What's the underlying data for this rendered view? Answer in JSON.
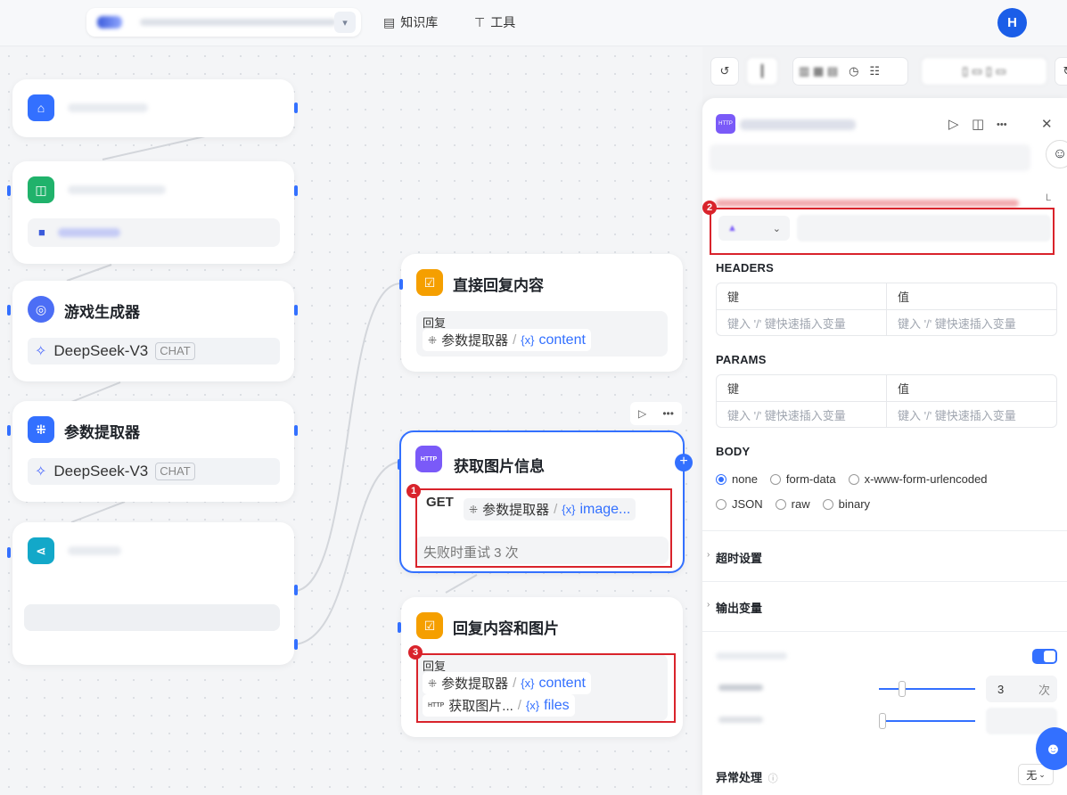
{
  "topbar": {
    "nav": [
      {
        "label": "知识库",
        "icon": "book-icon"
      },
      {
        "label": "工具",
        "icon": "tool-icon"
      }
    ],
    "avatar_letter": "H"
  },
  "canvas": {
    "nodes": {
      "game_gen": {
        "title": "游戏生成器",
        "model": "DeepSeek-V3",
        "tag": "CHAT"
      },
      "param_extract": {
        "title": "参数提取器",
        "model": "DeepSeek-V3",
        "tag": "CHAT"
      },
      "direct_reply": {
        "title": "直接回复内容",
        "sub_label": "回复",
        "var_source": "参数提取器",
        "var_name": "content"
      },
      "http_node": {
        "title": "获取图片信息",
        "icon_text": "HTTP",
        "method": "GET",
        "var_source": "参数提取器",
        "var_name": "image...",
        "retry_text": "失败时重试 3 次"
      },
      "reply_images": {
        "title": "回复内容和图片",
        "sub_label": "回复",
        "vars": [
          {
            "source": "参数提取器",
            "name": "content",
            "prefix_icon": "grid-icon"
          },
          {
            "source": "获取图片...",
            "name": "files",
            "prefix_icon": "http-icon"
          }
        ]
      }
    },
    "badges": [
      "1",
      "2",
      "3"
    ],
    "var_symbol": "{x}",
    "var_sep": "/"
  },
  "panel": {
    "header_icon_text": "HTTP",
    "corner_letter": "L",
    "headers": {
      "label": "HEADERS",
      "col_key": "键",
      "col_value": "值",
      "placeholder": "键入 '/' 键快速插入变量"
    },
    "params": {
      "label": "PARAMS",
      "col_key": "键",
      "col_value": "值",
      "placeholder": "键入 '/' 键快速插入变量"
    },
    "body": {
      "label": "BODY",
      "options": [
        "none",
        "form-data",
        "x-www-form-urlencoded",
        "JSON",
        "raw",
        "binary"
      ],
      "selected": "none"
    },
    "timeout_label": "超时设置",
    "output_label": "输出变量",
    "retry_count": "3",
    "retry_unit": "次",
    "exception_label": "异常处理",
    "exception_value": "无"
  }
}
